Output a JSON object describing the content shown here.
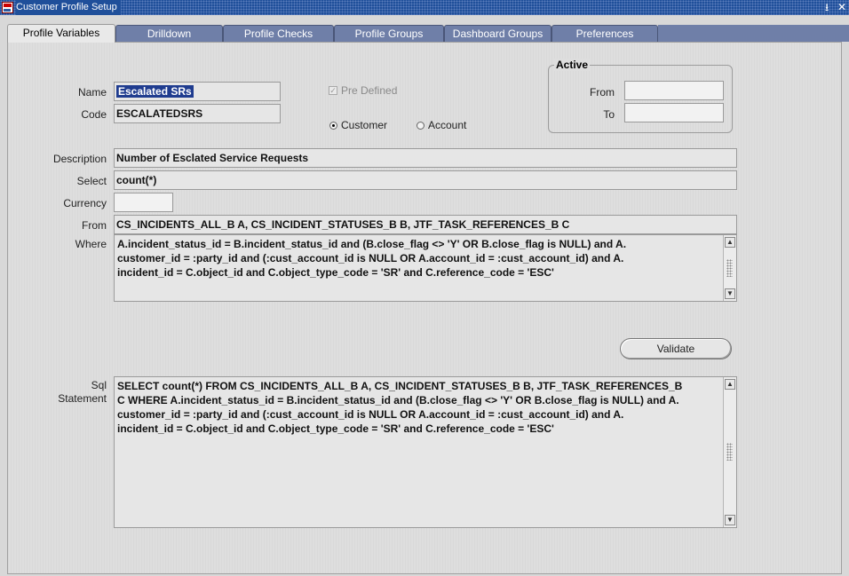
{
  "window": {
    "title": "Customer Profile Setup"
  },
  "tabs": [
    {
      "label": "Profile Variables",
      "active": true
    },
    {
      "label": "Drilldown",
      "active": false
    },
    {
      "label": "Profile Checks",
      "active": false
    },
    {
      "label": "Profile Groups",
      "active": false
    },
    {
      "label": "Dashboard Groups",
      "active": false
    },
    {
      "label": "Preferences",
      "active": false
    }
  ],
  "form": {
    "name_label": "Name",
    "name_value": "Escalated SRs",
    "code_label": "Code",
    "code_value": "ESCALATEDSRS",
    "predefined_label": "Pre Defined",
    "predefined_checked": true,
    "level_options": [
      {
        "label": "Customer",
        "selected": true
      },
      {
        "label": "Account",
        "selected": false
      }
    ],
    "active_group_title": "Active",
    "from_label": "From",
    "from_value": "",
    "to_label": "To",
    "to_value": "",
    "description_label": "Description",
    "description_value": "Number of Esclated Service Requests",
    "select_label": "Select",
    "select_value": "count(*)",
    "currency_label": "Currency",
    "currency_value": "",
    "from_clause_label": "From",
    "from_clause_value": "CS_INCIDENTS_ALL_B A, CS_INCIDENT_STATUSES_B B, JTF_TASK_REFERENCES_B C",
    "where_label": "Where",
    "where_lines": [
      "A.incident_status_id = B.incident_status_id and (B.close_flag <> 'Y' OR B.close_flag is NULL) and A.",
      "customer_id = :party_id and (:cust_account_id is NULL OR  A.account_id = :cust_account_id) and A.",
      "incident_id = C.object_id and C.object_type_code = 'SR' and C.reference_code = 'ESC'"
    ],
    "validate_button": "Validate",
    "sql_label_1": "Sql",
    "sql_label_2": "Statement",
    "sql_lines": [
      "SELECT count(*) FROM CS_INCIDENTS_ALL_B A, CS_INCIDENT_STATUSES_B B, JTF_TASK_REFERENCES_B",
      "C WHERE A.incident_status_id = B.incident_status_id and (B.close_flag <> 'Y' OR B.close_flag is NULL) and A.",
      "customer_id = :party_id and (:cust_account_id is NULL OR  A.account_id = :cust_account_id) and A.",
      "incident_id = C.object_id and C.object_type_code = 'SR' and C.reference_code = 'ESC'"
    ]
  },
  "icons": {
    "app": "oracle-app-icon",
    "minimize": "minimize-icon",
    "close": "close-icon"
  }
}
